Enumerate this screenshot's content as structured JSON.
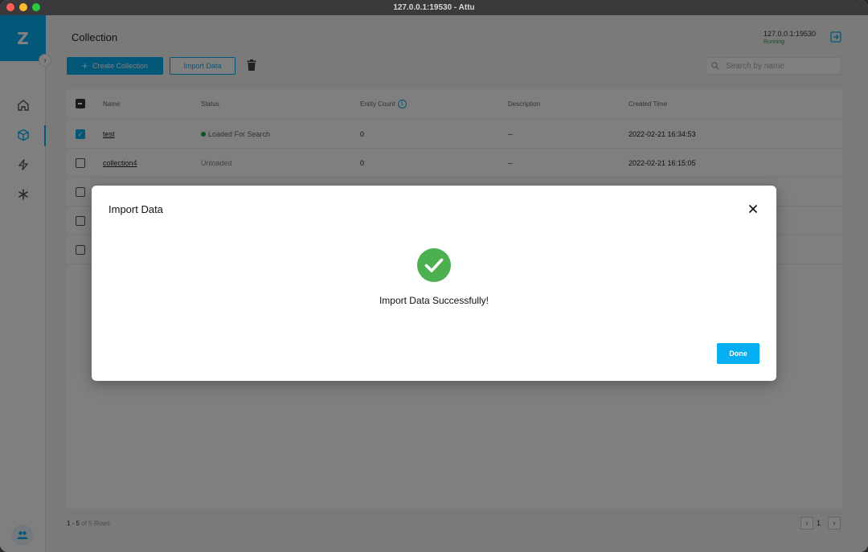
{
  "window": {
    "title": "127.0.0.1:19530 - Attu"
  },
  "sidebar": {
    "logo": "Z",
    "items": [
      {
        "name": "home",
        "icon": "home-icon"
      },
      {
        "name": "collection",
        "icon": "cube-icon",
        "active": true
      },
      {
        "name": "console",
        "icon": "lightning-icon"
      },
      {
        "name": "system",
        "icon": "asterisk-icon"
      }
    ],
    "footer_icon": "users-icon"
  },
  "header": {
    "title": "Collection",
    "server": "127.0.0.1:19530",
    "server_status": "Running"
  },
  "toolbar": {
    "create_label": "Create Collection",
    "import_label": "Import Data",
    "search_placeholder": "Search by name"
  },
  "table": {
    "columns": [
      "Name",
      "Status",
      "Entity Count",
      "Description",
      "Created Time"
    ],
    "rows": [
      {
        "name": "test",
        "status": "Loaded For Search",
        "entity_count": "0",
        "description": "--",
        "created": "2022-02-21 16:34:53",
        "checked": true
      },
      {
        "name": "collection4",
        "status": "Unloaded",
        "entity_count": "0",
        "description": "--",
        "created": "2022-02-21 16:15:05",
        "checked": false
      }
    ]
  },
  "footer": {
    "range": "1 - 5",
    "total": "of 5 Rows",
    "page": "1"
  },
  "dialog": {
    "title": "Import Data",
    "message": "Import Data Successfully!",
    "done_label": "Done"
  },
  "colors": {
    "accent": "#06aff2",
    "success": "#4caf50",
    "status_loaded": "#1ba34a"
  }
}
